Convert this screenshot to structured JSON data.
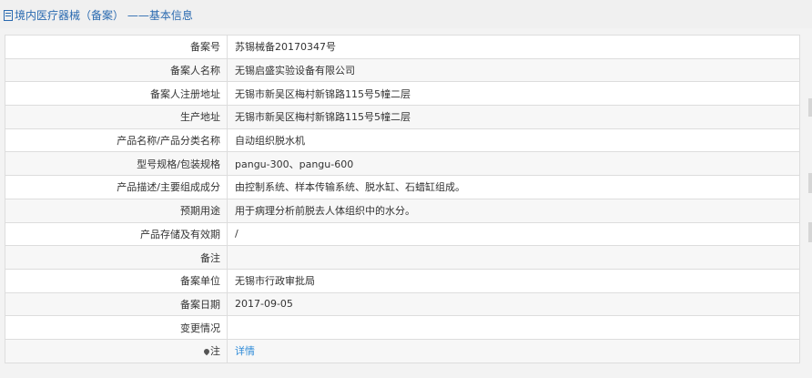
{
  "page": {
    "title": "境内医疗器械（备案） ——基本信息"
  },
  "rows": [
    {
      "label": "备案号",
      "value": "苏锡械备20170347号"
    },
    {
      "label": "备案人名称",
      "value": "无锡启盛实验设备有限公司"
    },
    {
      "label": "备案人注册地址",
      "value": "无锡市新吴区梅村新锦路115号5幢二层"
    },
    {
      "label": "生产地址",
      "value": "无锡市新吴区梅村新锦路115号5幢二层"
    },
    {
      "label": "产品名称/产品分类名称",
      "value": "自动组织脱水机"
    },
    {
      "label": "型号规格/包装规格",
      "value": "pangu-300、pangu-600"
    },
    {
      "label": "产品描述/主要组成成分",
      "value": "由控制系统、样本传输系统、脱水缸、石蜡缸组成。"
    },
    {
      "label": "预期用途",
      "value": "用于病理分析前脱去人体组织中的水分。"
    },
    {
      "label": "产品存储及有效期",
      "value": "/"
    },
    {
      "label": "备注",
      "value": ""
    },
    {
      "label": "备案单位",
      "value": "无锡市行政审批局"
    },
    {
      "label": "备案日期",
      "value": "2017-09-05"
    },
    {
      "label": "变更情况",
      "value": ""
    }
  ],
  "note_row": {
    "icon": "pin-icon",
    "label": "注",
    "link_text": "详情",
    "link_color": "#2e8bd8"
  },
  "colors": {
    "title": "#2a6ab0",
    "border": "#dddddd",
    "stripe": "#f7f7f7",
    "header_bg": "#f0f0f0"
  }
}
